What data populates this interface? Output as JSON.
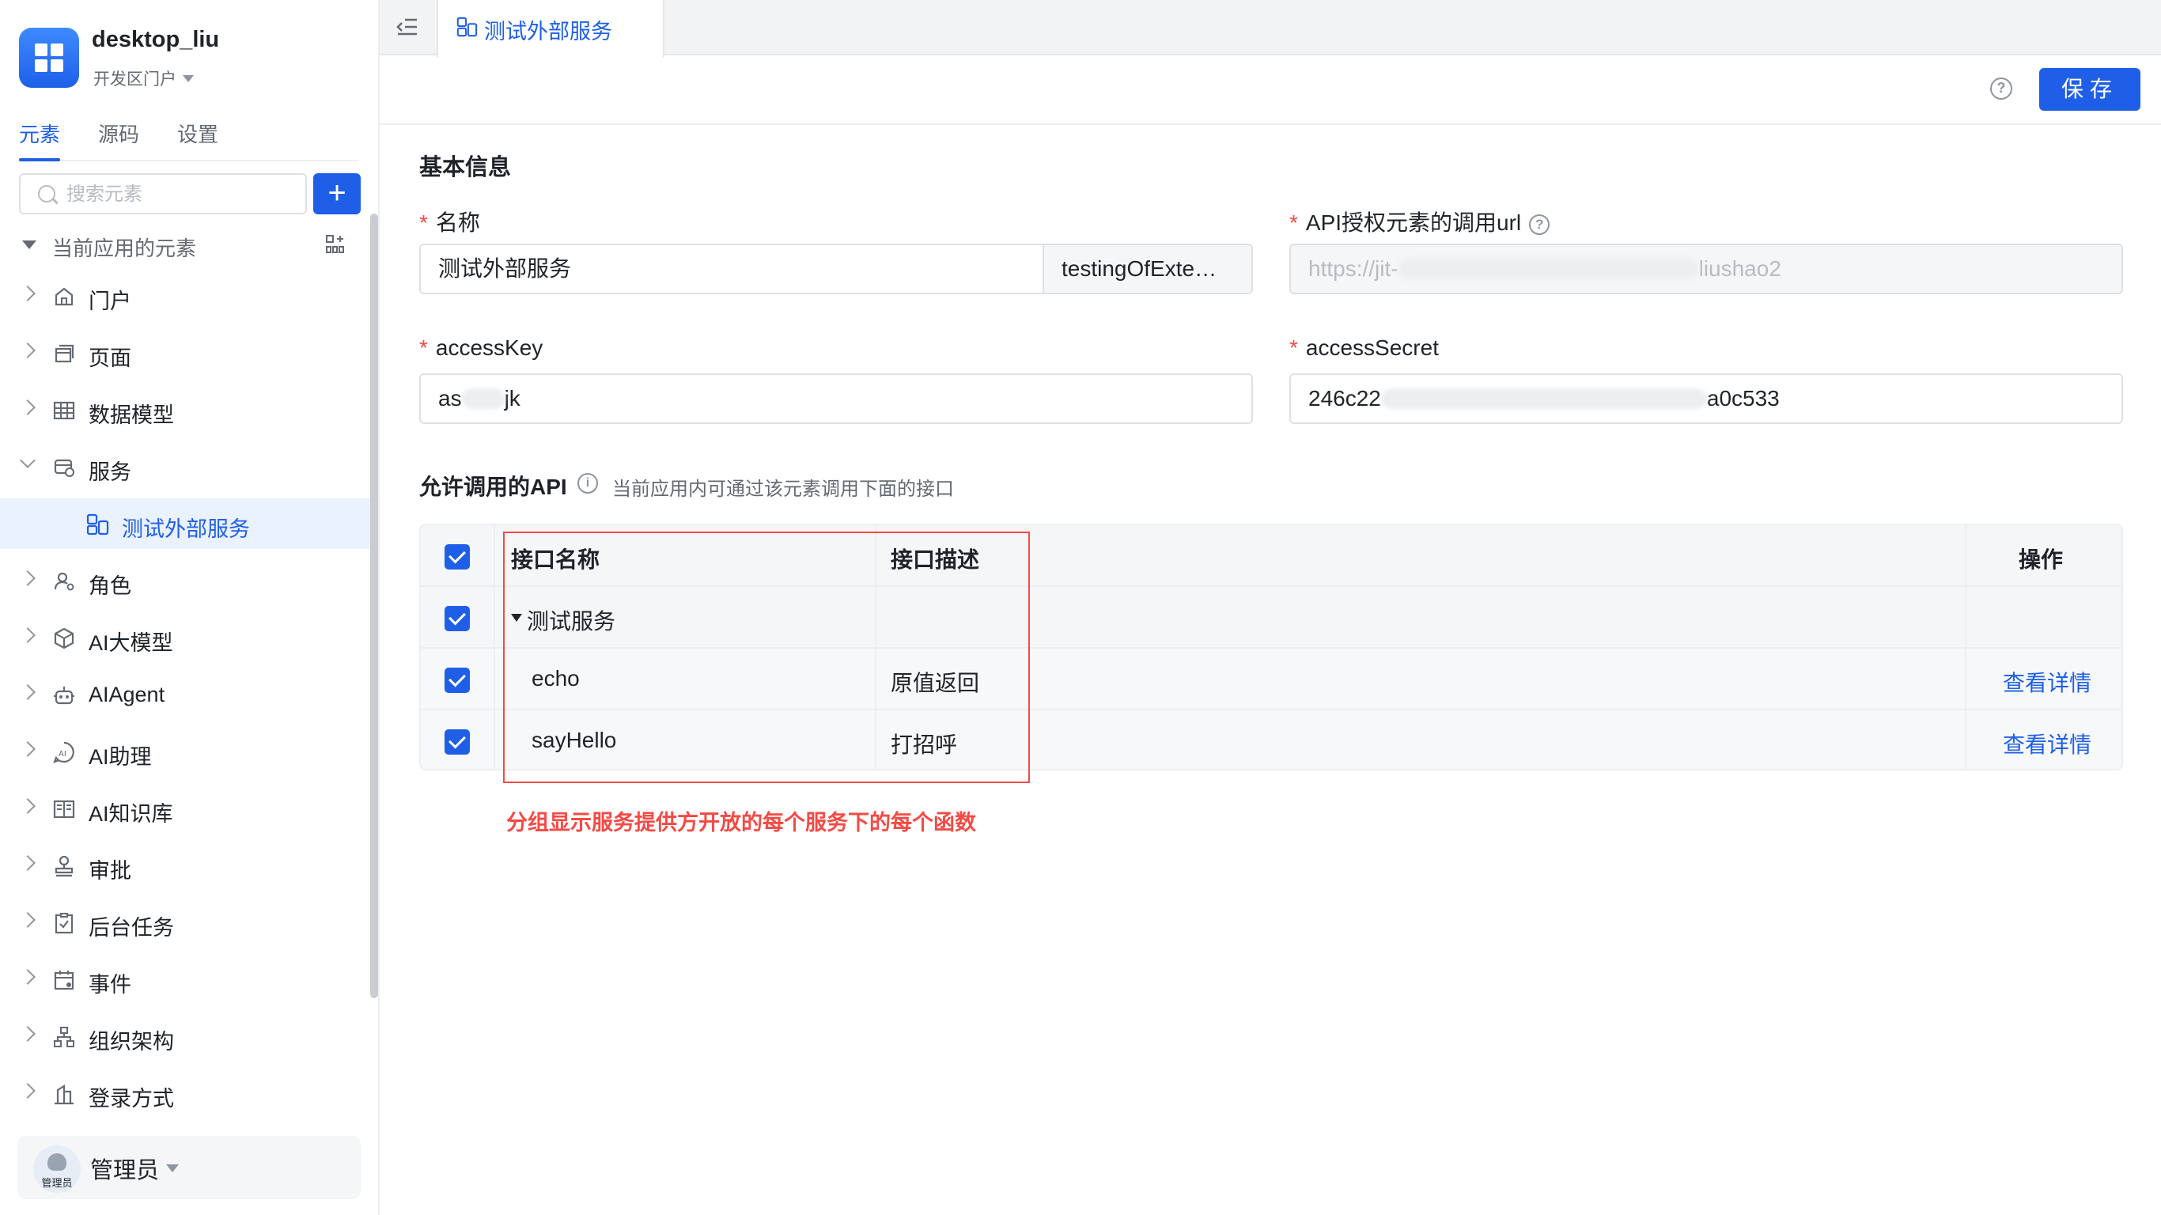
{
  "app": {
    "name": "desktop_liu",
    "subtitle": "开发区门户"
  },
  "sidebar": {
    "tabs": [
      {
        "label": "元素"
      },
      {
        "label": "源码"
      },
      {
        "label": "设置"
      }
    ],
    "search_placeholder": "搜索元素",
    "add_label": "+",
    "section_label": "当前应用的元素",
    "items": [
      {
        "label": "门户",
        "icon": "home-icon"
      },
      {
        "label": "页面",
        "icon": "page-icon"
      },
      {
        "label": "数据模型",
        "icon": "table-icon"
      },
      {
        "label": "服务",
        "icon": "service-icon",
        "expanded": true
      },
      {
        "label": "测试外部服务",
        "icon": "external-service-icon",
        "selected": true
      },
      {
        "label": "角色",
        "icon": "role-icon"
      },
      {
        "label": "AI大模型",
        "icon": "ai-model-icon"
      },
      {
        "label": "AIAgent",
        "icon": "robot-icon"
      },
      {
        "label": "AI助理",
        "icon": "ai-assistant-icon"
      },
      {
        "label": "AI知识库",
        "icon": "book-icon"
      },
      {
        "label": "审批",
        "icon": "approval-icon"
      },
      {
        "label": "后台任务",
        "icon": "task-icon"
      },
      {
        "label": "事件",
        "icon": "calendar-icon"
      },
      {
        "label": "组织架构",
        "icon": "org-icon"
      },
      {
        "label": "登录方式",
        "icon": "login-icon"
      }
    ],
    "user": {
      "name": "管理员",
      "avatar_tag": "管理员"
    }
  },
  "topbar": {
    "tab_label": "测试外部服务"
  },
  "toolbar": {
    "save_label": "保存"
  },
  "form": {
    "section_title": "基本信息",
    "name_label": "名称",
    "name_value": "测试外部服务",
    "name_id": "testingOfExte…",
    "url_label": "API授权元素的调用url",
    "url_prefix": "https://jit-",
    "url_suffix": "liushao2",
    "access_key_label": "accessKey",
    "access_key_prefix": "as",
    "access_key_suffix": "jk",
    "access_secret_label": "accessSecret",
    "access_secret_prefix": "246c22",
    "access_secret_suffix": "a0c533",
    "required_mark": "*"
  },
  "api": {
    "title": "允许调用的API",
    "hint": "当前应用内可通过该元素调用下面的接口",
    "columns": {
      "name": "接口名称",
      "desc": "接口描述",
      "action": "操作"
    },
    "group": "测试服务",
    "rows": [
      {
        "name": "echo",
        "desc": "原值返回",
        "action": "查看详情"
      },
      {
        "name": "sayHello",
        "desc": "打招呼",
        "action": "查看详情"
      }
    ]
  },
  "annotation": "分组显示服务提供方开放的每个服务下的每个函数",
  "colors": {
    "accent": "#1f5fe8",
    "annotation": "#f54a45"
  }
}
